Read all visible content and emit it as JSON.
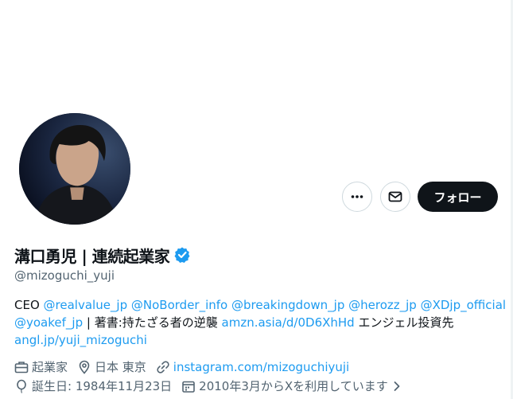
{
  "profile": {
    "display_name": "溝口勇児 | 連続起業家",
    "handle": "@mizoguchi_yuji",
    "follow_label": "フォロー",
    "verified_color": "#1d9bf0"
  },
  "bio": {
    "line1": [
      {
        "text": "CEO ",
        "link": false
      },
      {
        "text": "@realvalue_jp",
        "link": true
      },
      {
        "text": " ",
        "link": false
      },
      {
        "text": "@NoBorder_info",
        "link": true
      },
      {
        "text": " ",
        "link": false
      },
      {
        "text": "@breakingdown_jp",
        "link": true
      },
      {
        "text": " ",
        "link": false
      },
      {
        "text": "@herozz_jp",
        "link": true
      },
      {
        "text": " ",
        "link": false
      },
      {
        "text": "@XDjp_official",
        "link": true
      }
    ],
    "line2": [
      {
        "text": "@yoakef_jp",
        "link": true
      },
      {
        "text": " | 著書:持たざる者の逆襲 ",
        "link": false
      },
      {
        "text": "amzn.asia/d/0D6XhHd",
        "link": true
      },
      {
        "text": " エンジェル投資先",
        "link": false
      }
    ],
    "line3": [
      {
        "text": "angl.jp/yuji_mizoguchi",
        "link": true
      }
    ]
  },
  "meta": {
    "category": "起業家",
    "location": "日本 東京",
    "website": "instagram.com/mizoguchiyuji",
    "birthday": "誕生日: 1984年11月23日",
    "joined": "2010年3月からXを利用しています"
  },
  "icons": [
    "more-icon",
    "mail-icon",
    "verified-badge-icon",
    "briefcase-icon",
    "location-pin-icon",
    "link-icon",
    "balloon-icon",
    "calendar-icon",
    "chevron-right-icon"
  ]
}
